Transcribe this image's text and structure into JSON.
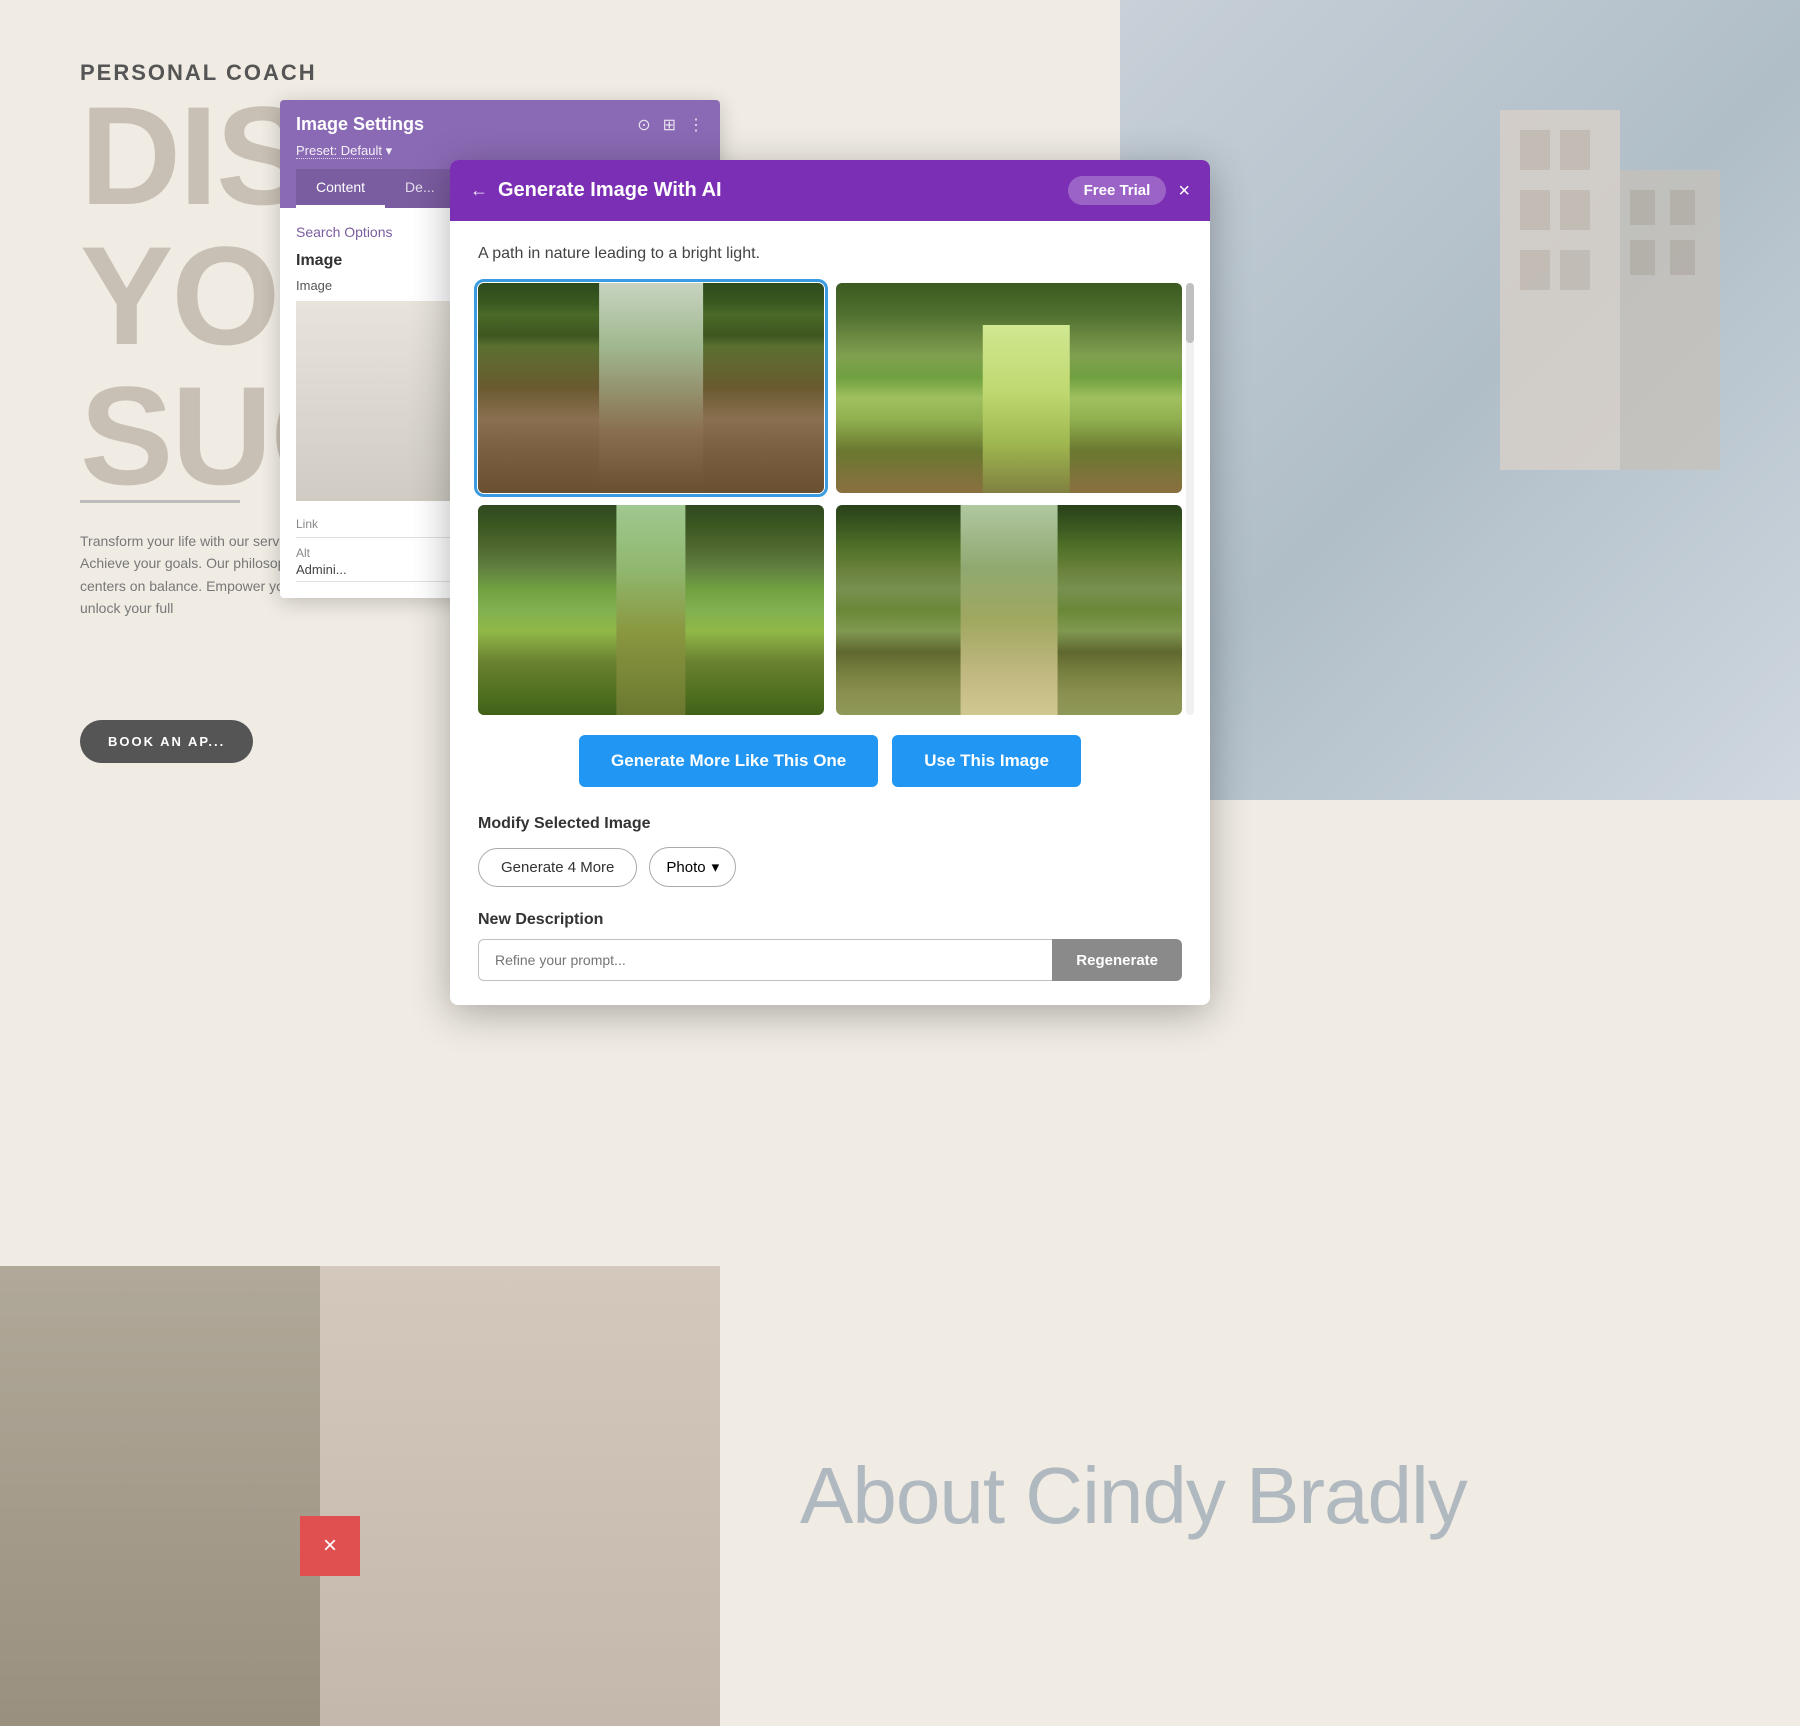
{
  "background": {
    "personal_coach_label": "PERSONAL COACH",
    "heading_line1": "DISC",
    "heading_line2": "YO",
    "heading_line3": "SUC",
    "paragraph": "Transform your life with our services. Achieve your goals. Our philosophy centers on balance. Empower yourself to unlock your full",
    "book_btn": "BOOK AN AP...",
    "about_text": "About Cindy Bradly"
  },
  "image_settings": {
    "title": "Image Settings",
    "preset_label": "Preset: Default",
    "tabs": [
      "Content",
      "De..."
    ],
    "search_options": "Search Options",
    "image_section": "Image",
    "image_label": "Image",
    "fields": {
      "link_label": "Link",
      "link_value": "",
      "alt_label": "Alt",
      "alt_value": "Admini..."
    },
    "icons": {
      "icon1": "⊙",
      "icon2": "⊞",
      "icon3": "⋮"
    }
  },
  "ai_modal": {
    "title": "Generate Image With AI",
    "back_icon": "←",
    "close_icon": "×",
    "free_trial_label": "Free Trial",
    "prompt_text": "A path in nature leading to a bright light.",
    "images": [
      {
        "id": 1,
        "alt": "Forest path winding through tall pine trees",
        "selected": true
      },
      {
        "id": 2,
        "alt": "Sunlit forest path with bright light",
        "selected": false
      },
      {
        "id": 3,
        "alt": "Green forest path through deciduous trees",
        "selected": false
      },
      {
        "id": 4,
        "alt": "Bamboo forest path",
        "selected": false
      }
    ],
    "generate_more_btn": "Generate More Like This One",
    "use_image_btn": "Use This Image",
    "modify_section_title": "Modify Selected Image",
    "generate4_btn": "Generate 4 More",
    "photo_option": "Photo",
    "new_description_title": "New Description",
    "new_desc_placeholder": "Refine your prompt...",
    "regenerate_btn": "Regenerate"
  },
  "red_x": "×"
}
